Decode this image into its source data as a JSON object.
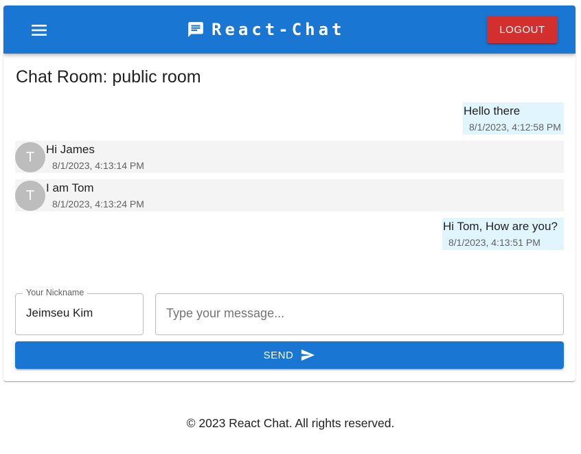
{
  "header": {
    "title": "React-Chat",
    "logout_label": "LOGOUT",
    "menu_icon": "menu-icon",
    "brand_icon": "chat-icon",
    "colors": {
      "appbar": "#1976d2",
      "logout": "#d32f2f"
    }
  },
  "room": {
    "title": "Chat Room: public room"
  },
  "messages": [
    {
      "sender": "me",
      "text": "Hello there",
      "time": "8/1/2023, 4:12:58 PM"
    },
    {
      "sender": "other",
      "avatar": "T",
      "text": "Hi James",
      "time": "8/1/2023, 4:13:14 PM"
    },
    {
      "sender": "other",
      "avatar": "T",
      "text": "I am Tom",
      "time": "8/1/2023, 4:13:24 PM"
    },
    {
      "sender": "me",
      "text": "Hi Tom, How are you?",
      "time": "8/1/2023, 4:13:51 PM"
    }
  ],
  "composer": {
    "nickname_label": "Your Nickname",
    "nickname_value": "Jeimseu Kim",
    "message_placeholder": "Type your message...",
    "message_value": "",
    "send_label": "SEND",
    "send_icon": "send-icon"
  },
  "footer": {
    "text": "© 2023 React Chat. All rights reserved."
  }
}
